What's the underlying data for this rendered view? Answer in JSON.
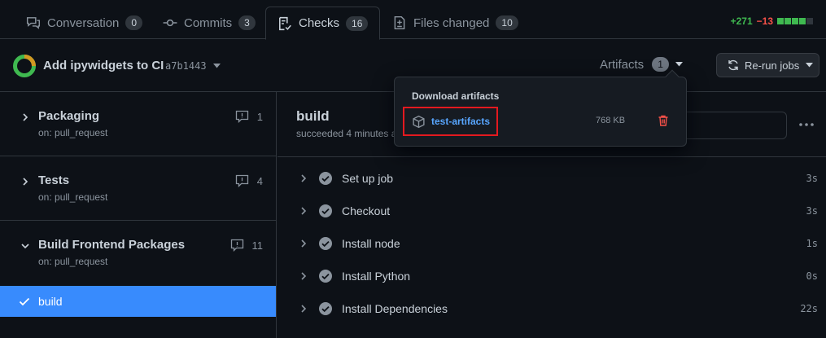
{
  "tabs": [
    {
      "label": "Conversation",
      "count": "0",
      "icon": "comment-discussion-icon"
    },
    {
      "label": "Commits",
      "count": "3",
      "icon": "git-commit-icon"
    },
    {
      "label": "Checks",
      "count": "16",
      "icon": "checklist-icon"
    },
    {
      "label": "Files changed",
      "count": "10",
      "icon": "file-diff-icon"
    }
  ],
  "diffstat": {
    "additions": "+271",
    "deletions": "−13"
  },
  "header": {
    "title": "Add ipywidgets to CI",
    "sha": "a7b1443",
    "artifacts_label": "Artifacts",
    "artifacts_count": "1",
    "rerun_label": "Re-run jobs"
  },
  "sidebar": {
    "groups": [
      {
        "name": "Packaging",
        "trigger": "on: pull_request",
        "count": "1"
      },
      {
        "name": "Tests",
        "trigger": "on: pull_request",
        "count": "4"
      },
      {
        "name": "Build Frontend Packages",
        "trigger": "on: pull_request",
        "count": "11"
      }
    ],
    "active_job": "build"
  },
  "main": {
    "title": "build",
    "subtitle": "succeeded 4 minutes a",
    "steps": [
      {
        "name": "Set up job",
        "time": "3s"
      },
      {
        "name": "Checkout",
        "time": "3s"
      },
      {
        "name": "Install node",
        "time": "1s"
      },
      {
        "name": "Install Python",
        "time": "0s"
      },
      {
        "name": "Install Dependencies",
        "time": "22s"
      }
    ]
  },
  "dropdown": {
    "heading": "Download artifacts",
    "artifact_name": "test-artifacts",
    "artifact_size": "768 KB"
  },
  "colors": {
    "success": "#3fb950",
    "danger": "#f85149",
    "accent": "#388bfd",
    "link": "#58a6ff",
    "highlight_box": "#e3191f"
  }
}
